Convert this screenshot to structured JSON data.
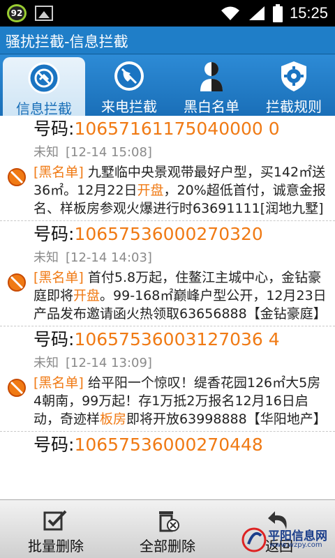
{
  "status_bar": {
    "badge": "92",
    "time": "15:25"
  },
  "title": "骚扰拦截-信息拦截",
  "tabs": [
    {
      "label": "信息拦截",
      "icon": "message-block-icon",
      "active": true
    },
    {
      "label": "来电拦截",
      "icon": "call-block-icon",
      "active": false
    },
    {
      "label": "黑白名单",
      "icon": "contact-list-icon",
      "active": false
    },
    {
      "label": "拦截规则",
      "icon": "gear-shield-icon",
      "active": false
    }
  ],
  "number_prefix": "号码:",
  "messages": [
    {
      "number": "10657161175040000 0",
      "sender": "未知",
      "date": "[12-14 15:08]",
      "tag": "[黑名单]",
      "text_a": " 九墅临中央景观带最好户型，买142㎡送36㎡。12月22日",
      "highlight": "开盘",
      "text_b": "，20%超低首付，诚意金报名、样板房参观火爆进行时63691111[润地九墅]"
    },
    {
      "number": "10657536000270320",
      "sender": "未知",
      "date": "[12-14 14:03]",
      "tag": "[黑名单]",
      "text_a": " 首付5.8万起，住鳌江主城中心，金钻豪庭即将",
      "highlight": "开盘",
      "text_b": "。99-168㎡巅峰户型公开，12月23日产品发布邀请函火热领取63656888【金钻豪庭】"
    },
    {
      "number": "10657536003127036 4",
      "sender": "未知",
      "date": "[12-14 13:09]",
      "tag": "[黑名单]",
      "text_a": " 给平阳一个惊叹！缇香花园126㎡大5房4朝南，99万起！存1万抵2万报名12月16日启动，奇迹样",
      "highlight": "板房",
      "text_b": "即将开放63998888【华阳地产】"
    },
    {
      "number": "10657536000270448",
      "sender": "",
      "date": "",
      "tag": "",
      "text_a": "",
      "highlight": "",
      "text_b": ""
    }
  ],
  "bottom": {
    "batch_delete": "批量删除",
    "delete_all": "全部删除",
    "back": "返回"
  },
  "watermark": {
    "name": "平阳信息网",
    "url": "www.wzpy.com"
  },
  "colors": {
    "accent": "#1f7ec8",
    "number": "#f07a14",
    "tag": "#f07a14"
  }
}
